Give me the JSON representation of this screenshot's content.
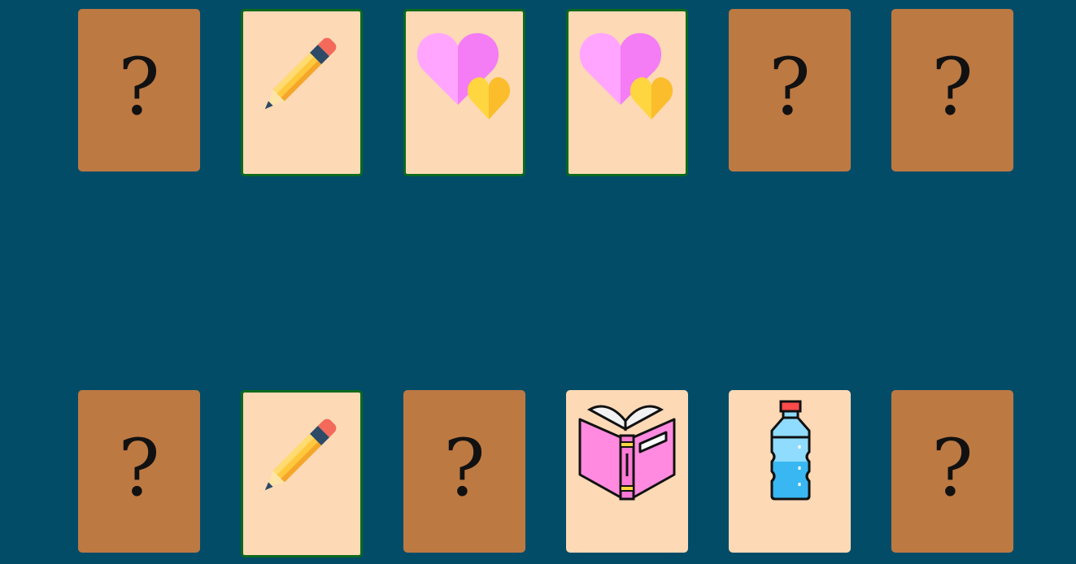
{
  "game": {
    "colors": {
      "background": "#034c68",
      "card_back": "#bd7942",
      "card_face": "#fdd9b6",
      "matched_border": "#0c6a1c"
    },
    "hidden_symbol": "?",
    "rows": [
      {
        "cards": [
          {
            "state": "hidden",
            "icon": null
          },
          {
            "state": "matched",
            "icon": "pencil-icon"
          },
          {
            "state": "matched",
            "icon": "hearts-icon"
          },
          {
            "state": "matched",
            "icon": "hearts-icon"
          },
          {
            "state": "hidden",
            "icon": null
          },
          {
            "state": "hidden",
            "icon": null
          }
        ]
      },
      {
        "cards": [
          {
            "state": "hidden",
            "icon": null
          },
          {
            "state": "matched",
            "icon": "pencil-icon"
          },
          {
            "state": "hidden",
            "icon": null
          },
          {
            "state": "revealed",
            "icon": "book-icon"
          },
          {
            "state": "revealed",
            "icon": "water-bottle-icon"
          },
          {
            "state": "hidden",
            "icon": null
          }
        ]
      }
    ]
  }
}
